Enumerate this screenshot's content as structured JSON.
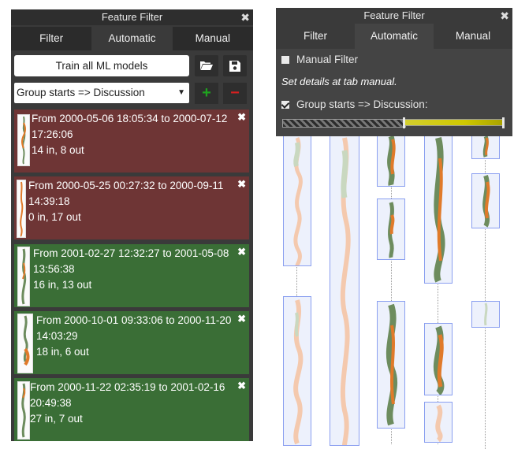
{
  "left_panel": {
    "title": "Feature Filter",
    "close_glyph": "✖",
    "tabs": [
      "Filter",
      "Automatic",
      "Manual"
    ],
    "active_tab": "Automatic",
    "train_button": "Train all ML models",
    "open_icon": "folder-open-icon",
    "save_icon": "floppy-disk-icon",
    "group_select": {
      "value": "Group starts => Discussion",
      "arrow": "▼"
    },
    "add_glyph": "+",
    "remove_glyph": "−",
    "cards": [
      {
        "line1": "From 2000-05-06 18:05:34 to 2000-07-12",
        "line2": "17:26:06",
        "line3": "14 in, 8 out",
        "status": "red"
      },
      {
        "line1": "From 2000-05-25 00:27:32 to 2000-09-11",
        "line2": "14:39:18",
        "line3": "0 in, 17 out",
        "status": "red"
      },
      {
        "line1": "From 2001-02-27 12:32:27 to 2001-05-08",
        "line2": "13:56:38",
        "line3": "16 in, 13 out",
        "status": "green"
      },
      {
        "line1": "From 2000-10-01 09:33:06 to 2000-11-20",
        "line2": "14:03:29",
        "line3": "18 in, 6 out",
        "status": "green"
      },
      {
        "line1": "From 2000-11-22 02:35:19 to 2001-02-16",
        "line2": "20:49:38",
        "line3": "27 in, 7 out",
        "status": "green"
      }
    ],
    "card_close_glyph": "✖"
  },
  "overlay": {
    "title": "Feature Filter",
    "close_glyph": "✖",
    "tabs": [
      "Filter",
      "Automatic",
      "Manual"
    ],
    "active_tab": "Automatic",
    "manual_filter_label": "Manual Filter",
    "manual_filter_checked": false,
    "note": "Set details at tab manual.",
    "group_label": "Group starts => Discussion:",
    "group_checked": true,
    "slider": {
      "low": 0.55,
      "high": 1.0
    }
  },
  "colors": {
    "red_card": "#6e3535",
    "green_card": "#3a6e36",
    "orange": "#e07a2a",
    "green_shape": "#6d8c5e",
    "box_border": "#8a9ff0"
  }
}
